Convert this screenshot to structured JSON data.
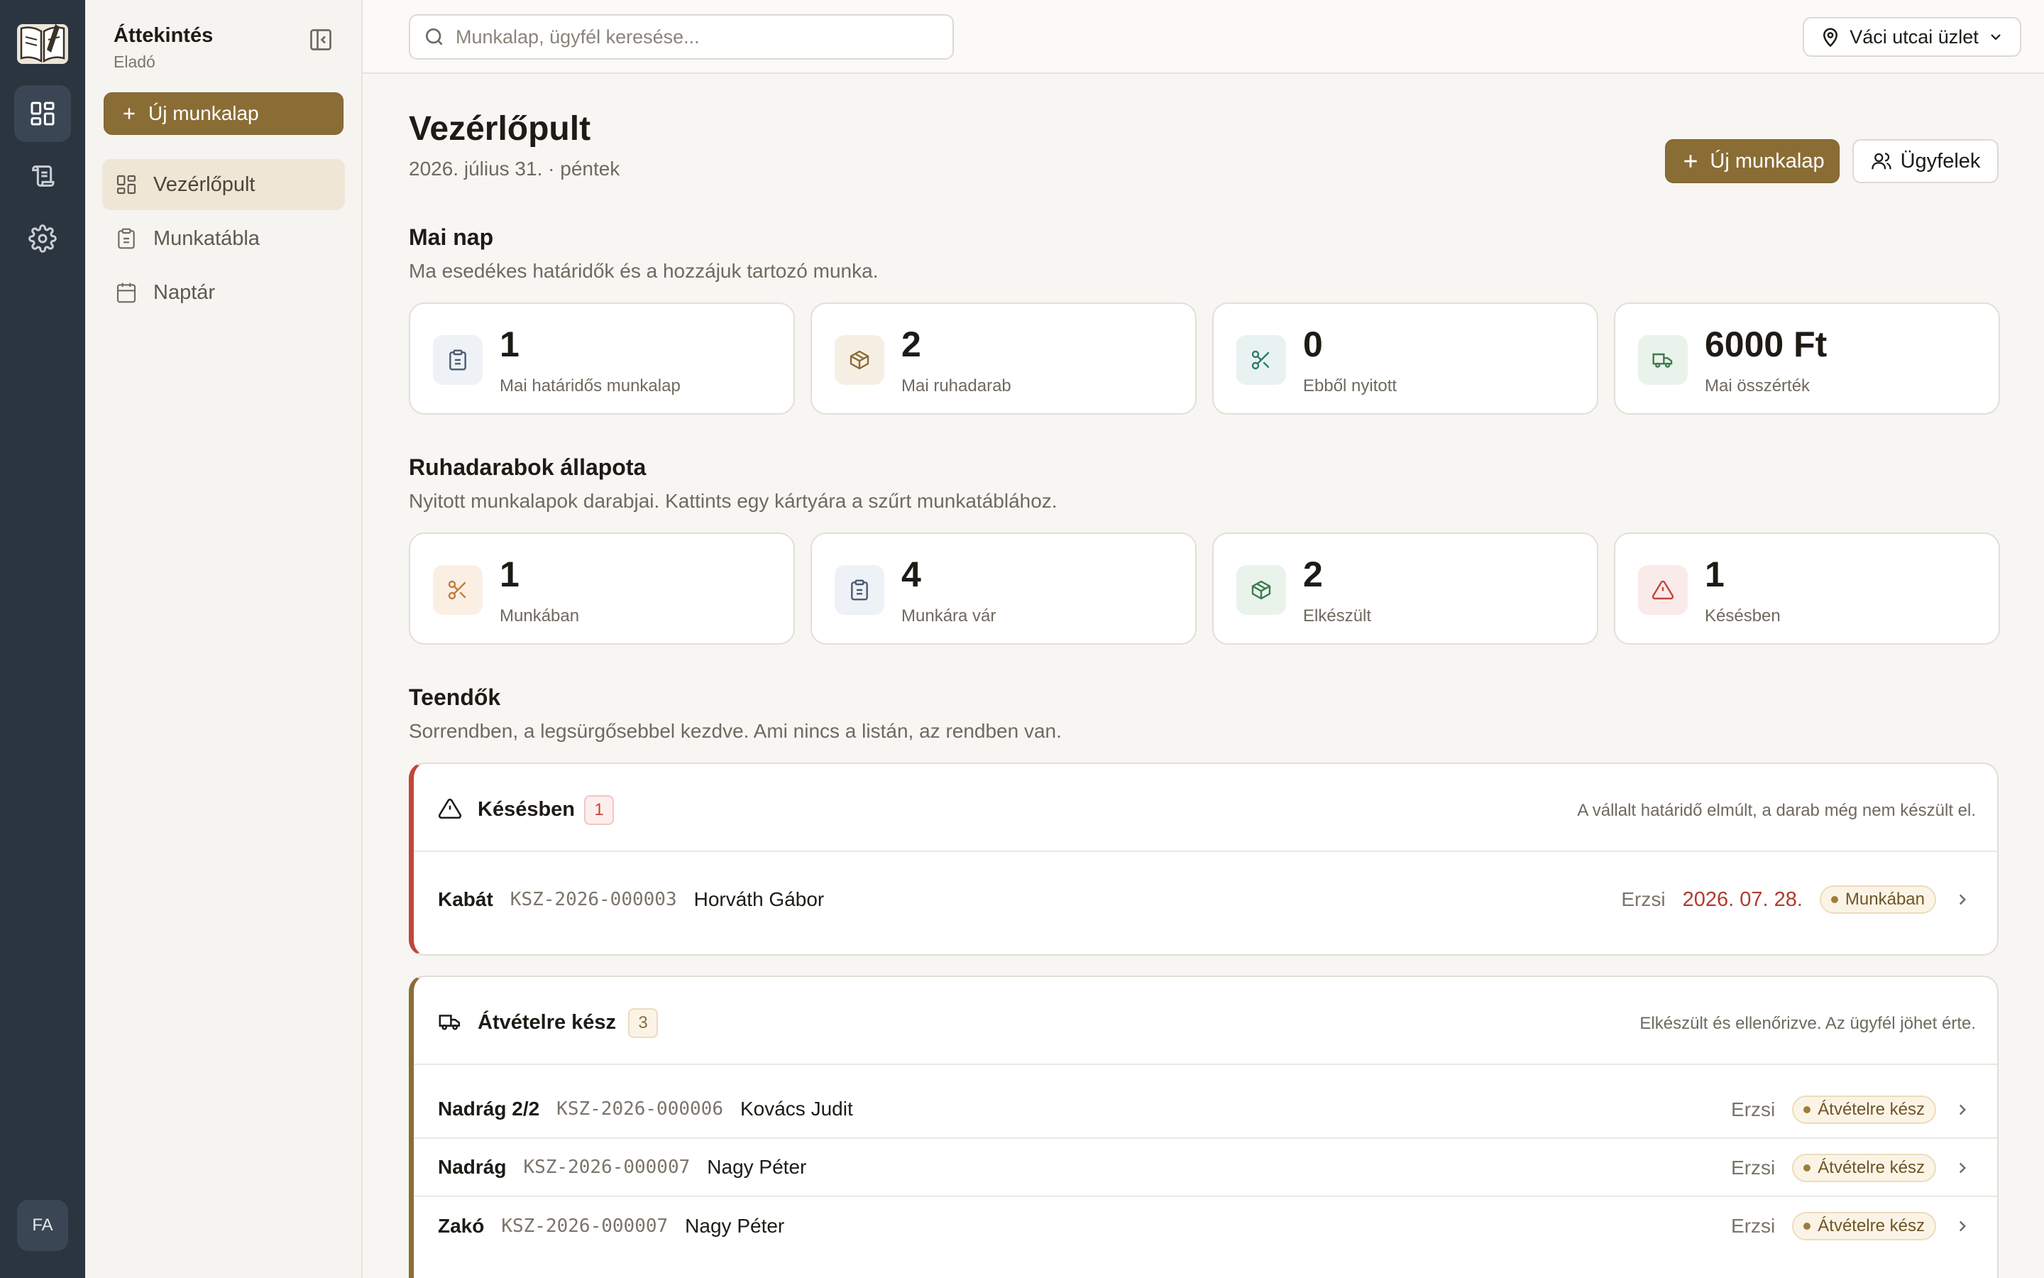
{
  "rail": {
    "avatar_initials": "FA"
  },
  "sidebar": {
    "title": "Áttekintés",
    "subtitle": "Eladó",
    "new_button": "Új munkalap",
    "items": [
      {
        "label": "Vezérlőpult",
        "active": true
      },
      {
        "label": "Munkatábla",
        "active": false
      },
      {
        "label": "Naptár",
        "active": false
      }
    ]
  },
  "topbar": {
    "search_placeholder": "Munkalap, ügyfél keresése...",
    "store": "Váci utcai üzlet"
  },
  "header": {
    "title": "Vezérlőpult",
    "date": "2026. július 31. · péntek",
    "new_button": "Új munkalap",
    "clients_button": "Ügyfelek"
  },
  "today": {
    "title": "Mai nap",
    "description": "Ma esedékes határidők és a hozzájuk tartozó munka.",
    "cards": [
      {
        "value": "1",
        "label": "Mai határidős munkalap",
        "icon": "clipboard-icon",
        "color": "#4a5a70"
      },
      {
        "value": "2",
        "label": "Mai ruhadarab",
        "icon": "package-icon",
        "color": "#8a6d35"
      },
      {
        "value": "0",
        "label": "Ebből nyitott",
        "icon": "scissors-icon",
        "color": "#2e7a6c"
      },
      {
        "value": "6000 Ft",
        "label": "Mai összérték",
        "icon": "truck-icon",
        "color": "#3e7a4f"
      }
    ]
  },
  "status_section": {
    "title": "Ruhadarabok állapota",
    "description": "Nyitott munkalapok darabjai. Kattints egy kártyára a szűrt munkatáblához.",
    "cards": [
      {
        "value": "1",
        "label": "Munkában",
        "icon": "scissors-icon",
        "color": "#c27a3a"
      },
      {
        "value": "4",
        "label": "Munkára vár",
        "icon": "clipboard-icon",
        "color": "#4a5a70"
      },
      {
        "value": "2",
        "label": "Elkészült",
        "icon": "package-icon",
        "color": "#3e7a4f"
      },
      {
        "value": "1",
        "label": "Késésben",
        "icon": "warning-icon",
        "color": "#c0463b"
      }
    ]
  },
  "todo": {
    "title": "Teendők",
    "description": "Sorrendben, a legsürgősebbel kezdve. Ami nincs a listán, az rendben van.",
    "groups": [
      {
        "name": "Késésben",
        "count": "1",
        "hint": "A vállalt határidő elmúlt, a darab még nem készült el.",
        "rows": [
          {
            "item": "Kabát",
            "code": "KSZ-2026-000003",
            "client": "Horváth Gábor",
            "staff": "Erzsi",
            "date": "2026. 07. 28.",
            "status": "Munkában"
          }
        ]
      },
      {
        "name": "Átvételre kész",
        "count": "3",
        "hint": "Elkészült és ellenőrizve. Az ügyfél jöhet érte.",
        "rows": [
          {
            "item": "Nadrág 2/2",
            "code": "KSZ-2026-000006",
            "client": "Kovács Judit",
            "staff": "Erzsi",
            "status": "Átvételre kész"
          },
          {
            "item": "Nadrág",
            "code": "KSZ-2026-000007",
            "client": "Nagy Péter",
            "staff": "Erzsi",
            "status": "Átvételre kész"
          },
          {
            "item": "Zakó",
            "code": "KSZ-2026-000007",
            "client": "Nagy Péter",
            "staff": "Erzsi",
            "status": "Átvételre kész"
          }
        ]
      }
    ]
  }
}
